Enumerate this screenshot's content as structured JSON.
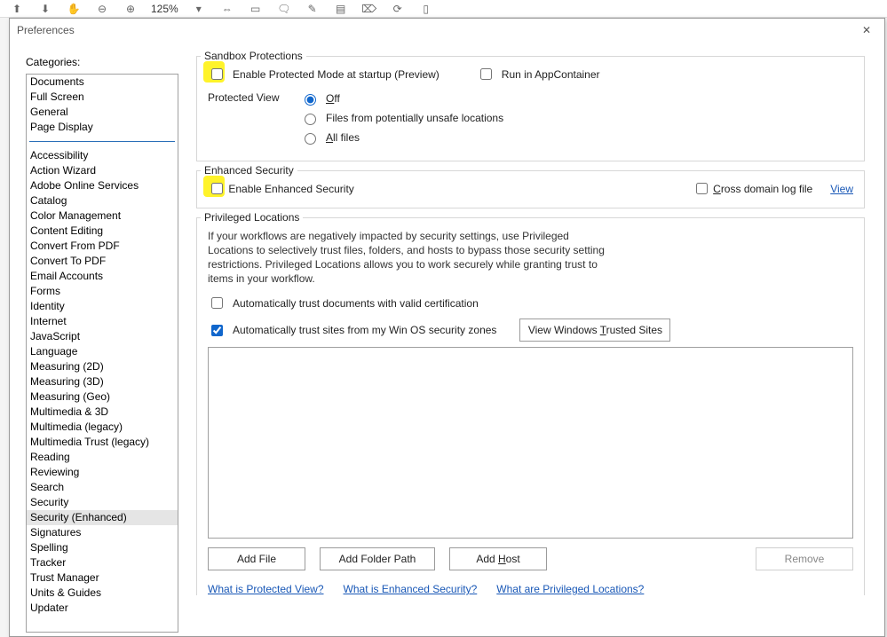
{
  "toolbar": {
    "zoom": "125%",
    "icons": [
      "up-icon",
      "down-icon",
      "divider",
      "minus-icon",
      "plus-icon",
      "zoom",
      "dropdown-icon",
      "fit-width-icon",
      "fit-page-icon",
      "divider",
      "note-icon",
      "pencil-icon",
      "highlight-icon",
      "stamp-icon",
      "draw-icon",
      "divider",
      "rotate-icon",
      "counter-icon"
    ]
  },
  "dialog": {
    "title": "Preferences"
  },
  "left": {
    "header": "Categories:"
  },
  "categories_top": [
    "Documents",
    "Full Screen",
    "General",
    "Page Display"
  ],
  "categories": [
    "Accessibility",
    "Action Wizard",
    "Adobe Online Services",
    "Catalog",
    "Color Management",
    "Content Editing",
    "Convert From PDF",
    "Convert To PDF",
    "Email Accounts",
    "Forms",
    "Identity",
    "Internet",
    "JavaScript",
    "Language",
    "Measuring (2D)",
    "Measuring (3D)",
    "Measuring (Geo)",
    "Multimedia & 3D",
    "Multimedia (legacy)",
    "Multimedia Trust (legacy)",
    "Reading",
    "Reviewing",
    "Search",
    "Security",
    "Security (Enhanced)",
    "Signatures",
    "Spelling",
    "Tracker",
    "Trust Manager",
    "Units & Guides",
    "Updater"
  ],
  "selected_category": "Security (Enhanced)",
  "sandbox": {
    "title": "Sandbox Protections",
    "protected_mode": "Enable Protected Mode at startup (Preview)",
    "app_container": "Run in AppContainer",
    "pv_label": "Protected View",
    "pv_off": "Off",
    "pv_files": "Files from potentially unsafe locations",
    "pv_all": "All files"
  },
  "enhanced": {
    "title": "Enhanced Security",
    "enable": "Enable Enhanced Security",
    "cross_domain": "Cross domain log file",
    "view": "View"
  },
  "priv": {
    "title": "Privileged Locations",
    "help": "If your workflows are negatively impacted by security settings, use Privileged Locations to selectively trust files, folders, and hosts to bypass those security setting restrictions. Privileged Locations allows you to work securely while granting trust to items in your workflow.",
    "trust_cert": "Automatically trust documents with valid certification",
    "trust_zones": "Automatically trust sites from my Win OS security zones",
    "view_trusted": "View Windows Trusted Sites",
    "add_file": "Add File",
    "add_folder": "Add Folder Path",
    "add_host": "Add Host",
    "remove": "Remove"
  },
  "links": {
    "pv": "What is Protected View?",
    "es": "What is Enhanced Security?",
    "pl": "What are Privileged Locations?"
  }
}
